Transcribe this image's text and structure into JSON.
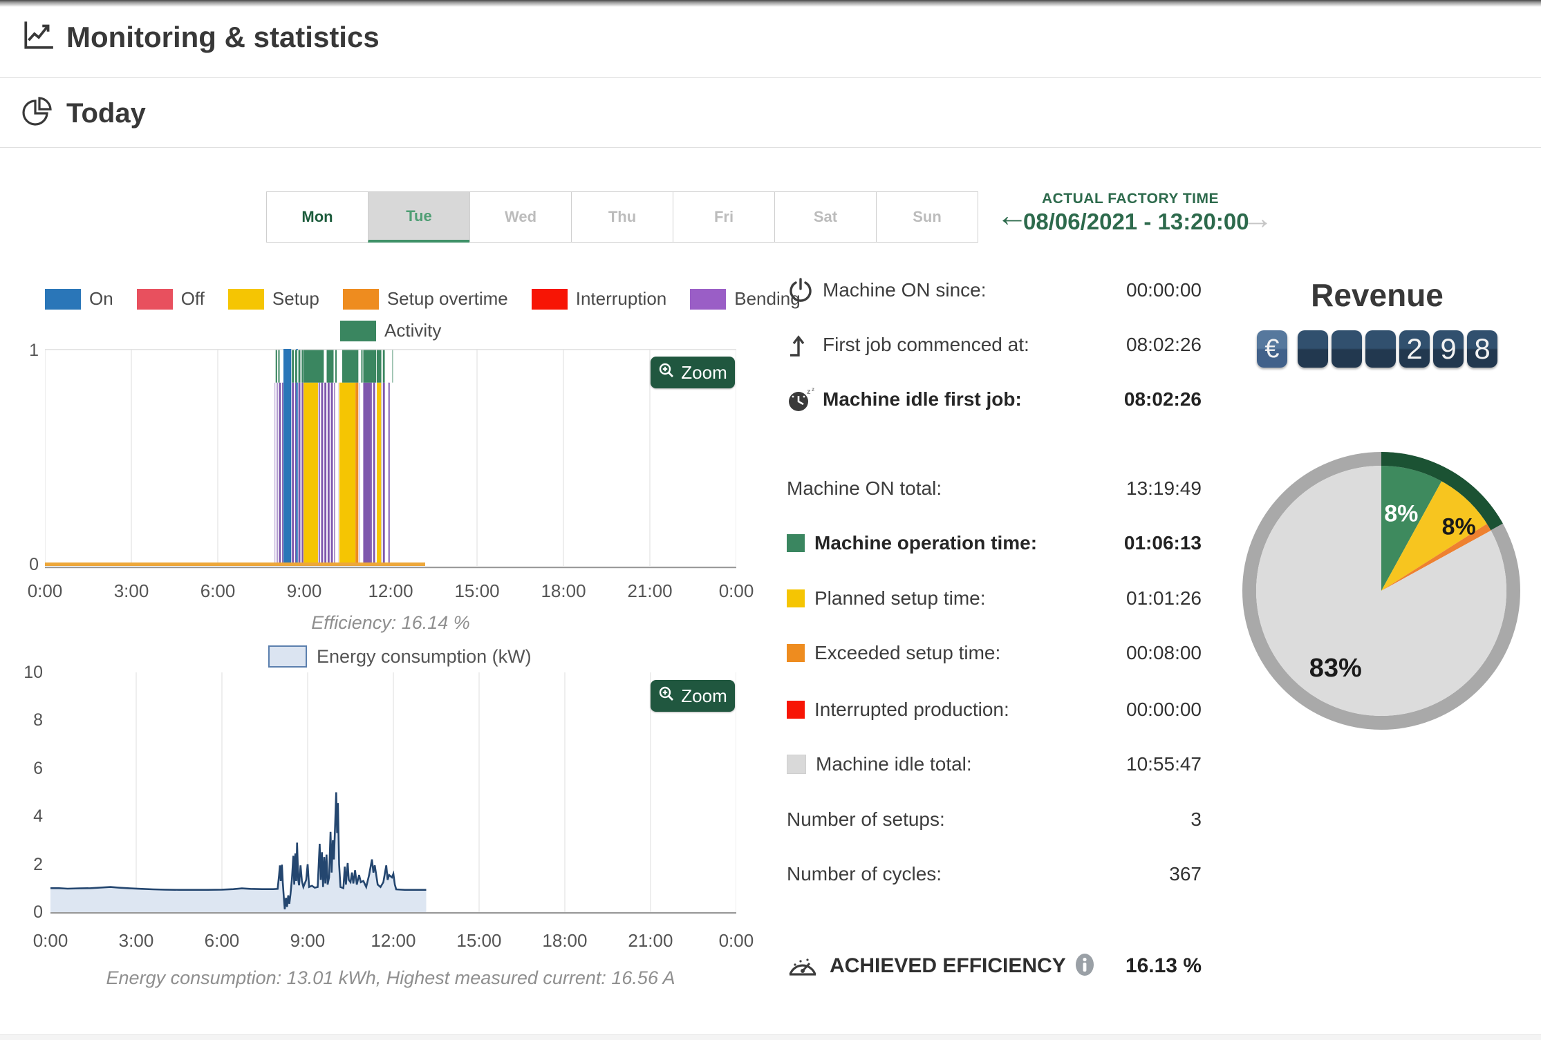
{
  "app": {
    "title": "Monitoring & statistics"
  },
  "section": {
    "title": "Today"
  },
  "toolbar": {
    "days": [
      {
        "label": "Mon",
        "state": "available"
      },
      {
        "label": "Tue",
        "state": "selected"
      },
      {
        "label": "Wed",
        "state": "disabled"
      },
      {
        "label": "Thu",
        "state": "disabled"
      },
      {
        "label": "Fri",
        "state": "disabled"
      },
      {
        "label": "Sat",
        "state": "disabled"
      },
      {
        "label": "Sun",
        "state": "disabled"
      }
    ],
    "factory_time": {
      "label": "ACTUAL FACTORY TIME",
      "value": "08/06/2021 - 13:20:00",
      "prev": "←",
      "next": "→"
    }
  },
  "legend": {
    "row1": [
      {
        "label": "On",
        "color": "#2a76b8"
      },
      {
        "label": "Off",
        "color": "#e8505e"
      },
      {
        "label": "Setup",
        "color": "#f5c503"
      },
      {
        "label": "Setup overtime",
        "color": "#ee8c1f"
      },
      {
        "label": "Interruption",
        "color": "#f71505"
      },
      {
        "label": "Bending",
        "color": "#9a5ec6"
      }
    ],
    "row2": [
      {
        "label": "Activity",
        "color": "#3a8660"
      }
    ]
  },
  "charts": {
    "zoom_label": "Zoom",
    "efficiency_caption": "Efficiency: 16.14 %",
    "energy_legend": "Energy consumption (kW)",
    "energy_caption": "Energy consumption: 13.01 kWh, Highest measured current: 16.56 A"
  },
  "stats": {
    "rows": [
      {
        "icon": "power-icon",
        "label": "Machine ON since:",
        "value": "00:00:00"
      },
      {
        "icon": "first-job-icon",
        "label": "First job commenced at:",
        "value": "08:02:26"
      },
      {
        "icon": "idle-clock-icon",
        "label": "Machine idle first job:",
        "value": "08:02:26",
        "bold": true
      },
      {
        "label": "Machine ON total:",
        "value": "13:19:49"
      },
      {
        "swatch": "#3a8660",
        "label": "Machine operation time:",
        "value": "01:06:13",
        "bold": true
      },
      {
        "swatch": "#f5c503",
        "label": "Planned setup time:",
        "value": "01:01:26"
      },
      {
        "swatch": "#ee8c1f",
        "label": "Exceeded setup time:",
        "value": "00:08:00"
      },
      {
        "swatch": "#f71505",
        "label": "Interrupted production:",
        "value": "00:00:00"
      },
      {
        "swatch": "#d9d9d9",
        "label": "Machine idle total:",
        "value": "10:55:47"
      },
      {
        "label": "Number of setups:",
        "value": "3"
      },
      {
        "label": "Number of cycles:",
        "value": "367"
      }
    ]
  },
  "efficiency": {
    "label": "ACHIEVED EFFICIENCY",
    "value": "16.13 %",
    "info_icon": "info-icon",
    "gauge_icon": "gauge-icon"
  },
  "revenue": {
    "title": "Revenue",
    "currency": "€",
    "digits": [
      "",
      "",
      "",
      "2",
      "9",
      "8"
    ]
  },
  "colors": {
    "accent_green_dark": "#20573f",
    "factory_time_green": "#2d6a4c",
    "selected_tab_underline": "#3f9168",
    "axis_text": "#555555",
    "caption_gray": "#8f8f8f"
  },
  "chart_data": [
    {
      "type": "bar",
      "name": "machine-status-timeline",
      "xrange": [
        0,
        24
      ],
      "ylim": [
        0,
        1
      ],
      "y_ticks": [
        "0",
        "1"
      ],
      "x_ticks": [
        "0:00",
        "3:00",
        "6:00",
        "9:00",
        "12:00",
        "15:00",
        "18:00",
        "21:00",
        "0:00"
      ],
      "band_split": 0.845,
      "baseline": {
        "from": 0,
        "to": 13.2,
        "color": "#eda73a"
      },
      "status_colors": {
        "blue": "#2a76b8",
        "yellow": "#f5c503",
        "orange": "#ee8c1f",
        "purple": "#7e57ad"
      },
      "activity_color": "#3a8660",
      "segments": [
        {
          "from": 7.98,
          "to": 8.05,
          "style": "purple_sparse"
        },
        {
          "from": 8.05,
          "to": 8.27,
          "style": "purple_dense"
        },
        {
          "from": 8.28,
          "to": 8.55,
          "style": "blue_full"
        },
        {
          "from": 8.56,
          "to": 8.72,
          "style": "purple_dense"
        },
        {
          "from": 8.72,
          "to": 8.78,
          "style": "blue_full"
        },
        {
          "from": 8.78,
          "to": 8.97,
          "style": "purple_dense"
        },
        {
          "from": 8.98,
          "to": 9.48,
          "style": "yellow"
        },
        {
          "from": 9.5,
          "to": 10.02,
          "style": "purple_dense"
        },
        {
          "from": 10.04,
          "to": 10.2,
          "style": "purple_sparse"
        },
        {
          "from": 10.22,
          "to": 10.78,
          "style": "yellow"
        },
        {
          "from": 10.78,
          "to": 10.88,
          "style": "orange"
        },
        {
          "from": 10.92,
          "to": 11.04,
          "style": "purple_sparse"
        },
        {
          "from": 11.05,
          "to": 11.32,
          "style": "purple"
        },
        {
          "from": 11.32,
          "to": 11.5,
          "style": "purple_dense"
        },
        {
          "from": 11.52,
          "to": 11.67,
          "style": "yellow"
        },
        {
          "from": 11.68,
          "to": 11.84,
          "style": "purple_dense"
        },
        {
          "from": 11.86,
          "to": 12.08,
          "style": "purple_sparse"
        }
      ],
      "activity_segments": [
        {
          "from": 7.98,
          "to": 8.06,
          "style": "dense"
        },
        {
          "from": 8.08,
          "to": 8.26,
          "style": "sparse"
        },
        {
          "from": 8.56,
          "to": 8.97,
          "style": "dense"
        },
        {
          "from": 8.98,
          "to": 9.68,
          "style": "solid"
        },
        {
          "from": 9.78,
          "to": 10.02,
          "style": "solid"
        },
        {
          "from": 10.04,
          "to": 10.2,
          "style": "sparse"
        },
        {
          "from": 10.32,
          "to": 10.88,
          "style": "solid"
        },
        {
          "from": 10.92,
          "to": 11.04,
          "style": "sparse"
        },
        {
          "from": 11.05,
          "to": 11.5,
          "style": "solid"
        },
        {
          "from": 11.52,
          "to": 11.67,
          "style": "solid"
        },
        {
          "from": 11.68,
          "to": 11.8,
          "style": "dense"
        },
        {
          "from": 11.95,
          "to": 12.08,
          "style": "sparse"
        }
      ]
    },
    {
      "type": "area",
      "name": "energy-consumption",
      "series_label": "Energy consumption (kW)",
      "xrange": [
        0,
        24
      ],
      "ylim": [
        0,
        10
      ],
      "y_ticks": [
        0,
        2,
        4,
        6,
        8,
        10
      ],
      "x_ticks": [
        "0:00",
        "3:00",
        "6:00",
        "9:00",
        "12:00",
        "15:00",
        "18:00",
        "21:00",
        "0:00"
      ],
      "colors": {
        "line": "#24466f",
        "fill": "#dde6f2"
      },
      "points": [
        [
          0,
          1.0
        ],
        [
          0.3,
          1.0
        ],
        [
          0.6,
          0.98
        ],
        [
          1,
          0.99
        ],
        [
          1.4,
          1.0
        ],
        [
          1.8,
          1.03
        ],
        [
          2.1,
          1.05
        ],
        [
          2.4,
          1.02
        ],
        [
          2.8,
          0.99
        ],
        [
          3.2,
          0.97
        ],
        [
          3.6,
          0.95
        ],
        [
          4,
          0.94
        ],
        [
          4.5,
          0.93
        ],
        [
          5,
          0.93
        ],
        [
          5.5,
          0.93
        ],
        [
          6,
          0.94
        ],
        [
          6.4,
          0.96
        ],
        [
          6.7,
          0.99
        ],
        [
          7,
          0.97
        ],
        [
          7.4,
          0.96
        ],
        [
          7.8,
          0.96
        ],
        [
          7.95,
          0.97
        ],
        [
          8,
          1.55
        ],
        [
          8.03,
          1.95
        ],
        [
          8.06,
          1.3
        ],
        [
          8.1,
          1.98
        ],
        [
          8.13,
          1.25
        ],
        [
          8.17,
          0.55
        ],
        [
          8.2,
          0.12
        ],
        [
          8.24,
          0.6
        ],
        [
          8.28,
          0.22
        ],
        [
          8.32,
          0.7
        ],
        [
          8.36,
          0.35
        ],
        [
          8.4,
          0.75
        ],
        [
          8.45,
          1.4
        ],
        [
          8.5,
          2.35
        ],
        [
          8.53,
          1.15
        ],
        [
          8.57,
          2.45
        ],
        [
          8.6,
          1.3
        ],
        [
          8.63,
          2.9
        ],
        [
          8.67,
          1.35
        ],
        [
          8.7,
          1.12
        ],
        [
          8.75,
          1.95
        ],
        [
          8.8,
          1.3
        ],
        [
          8.85,
          1.05
        ],
        [
          8.95,
          1.35
        ],
        [
          9,
          2.0
        ],
        [
          9.05,
          1.05
        ],
        [
          9.15,
          1.1
        ],
        [
          9.25,
          1.02
        ],
        [
          9.35,
          1.05
        ],
        [
          9.42,
          2.85
        ],
        [
          9.46,
          1.35
        ],
        [
          9.5,
          2.5
        ],
        [
          9.54,
          1.05
        ],
        [
          9.58,
          2.3
        ],
        [
          9.62,
          1.2
        ],
        [
          9.66,
          2.4
        ],
        [
          9.7,
          1.15
        ],
        [
          9.75,
          1.45
        ],
        [
          9.8,
          3.35
        ],
        [
          9.84,
          1.65
        ],
        [
          9.88,
          3.0
        ],
        [
          9.92,
          2.2
        ],
        [
          9.96,
          3.6
        ],
        [
          10,
          5.0
        ],
        [
          10.03,
          3.3
        ],
        [
          10.06,
          4.55
        ],
        [
          10.1,
          2.0
        ],
        [
          10.15,
          1.05
        ],
        [
          10.25,
          1.0
        ],
        [
          10.3,
          1.9
        ],
        [
          10.34,
          1.15
        ],
        [
          10.4,
          2.05
        ],
        [
          10.44,
          1.35
        ],
        [
          10.5,
          1.25
        ],
        [
          10.55,
          1.65
        ],
        [
          10.6,
          1.2
        ],
        [
          10.66,
          1.75
        ],
        [
          10.72,
          1.15
        ],
        [
          10.8,
          1.55
        ],
        [
          10.86,
          1.25
        ],
        [
          10.95,
          1.3
        ],
        [
          11.05,
          1.05
        ],
        [
          11.15,
          1.55
        ],
        [
          11.25,
          2.2
        ],
        [
          11.3,
          1.65
        ],
        [
          11.35,
          1.95
        ],
        [
          11.45,
          1.15
        ],
        [
          11.55,
          1.05
        ],
        [
          11.65,
          1.25
        ],
        [
          11.75,
          1.95
        ],
        [
          11.8,
          1.35
        ],
        [
          11.85,
          1.55
        ],
        [
          11.95,
          1.45
        ],
        [
          12,
          1.6
        ],
        [
          12.05,
          1.15
        ],
        [
          12.1,
          0.95
        ],
        [
          12.4,
          0.93
        ],
        [
          12.8,
          0.93
        ],
        [
          13.15,
          0.93
        ]
      ],
      "summary": {
        "total_kwh": 13.01,
        "highest_current_a": 16.56
      }
    },
    {
      "type": "pie",
      "name": "time-distribution",
      "slices": [
        {
          "value": 8,
          "color": "#3e8a5e",
          "label": "8%",
          "label_color": "#ffffff"
        },
        {
          "value": 8,
          "color": "#f7c51f",
          "label": "8%",
          "label_color": "#1a1a1a"
        },
        {
          "value": 1,
          "color": "#ee8130",
          "label": "",
          "label_color": ""
        },
        {
          "value": 83,
          "color": "#dcdcdc",
          "label": "83%",
          "label_color": "#1a1a1a"
        }
      ],
      "ring": {
        "color": "#a9a9a9",
        "highlight_color": "#1b5233",
        "highlight_deg": 61
      }
    }
  ]
}
